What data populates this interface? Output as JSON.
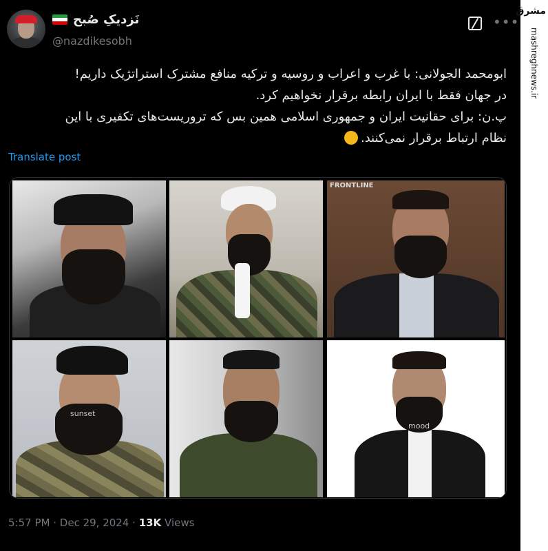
{
  "author": {
    "display_name": "نَزدیکِ صُبح",
    "handle": "@nazdikesobh",
    "flag_colors": [
      "#239f40",
      "#ffffff",
      "#da0000"
    ]
  },
  "tweet": {
    "lines": [
      "ابومحمد الجولانی: با غرب و اعراب و روسیه و ترکیه منافع مشترک استراتژیک داریم!",
      "در جهان فقط با ایران رابطه برقرار نخواهیم کرد.",
      "پ.ن: برای حقانیت ایران و جمهوری اسلامی همین بس که تروریست‌های تکفیری با این",
      "نظام ارتباط برقرار نمی‌کنند."
    ],
    "emoji": "ok-hand"
  },
  "translate_label": "Translate post",
  "media": {
    "watermarks": {
      "top_right": "FRONTLINE",
      "bottom_left": "sunset",
      "bottom_right": "mood"
    }
  },
  "footer": {
    "time": "5:57 PM",
    "sep": "·",
    "date": "Dec 29, 2024",
    "views_count": "13K",
    "views_label": "Views"
  },
  "side_watermark": {
    "logo": "مشرق",
    "url": "mashreghnews.ir"
  },
  "colors": {
    "background": "#000000",
    "text": "#e7e9ea",
    "muted": "#71767b",
    "link": "#1d9bf0"
  }
}
